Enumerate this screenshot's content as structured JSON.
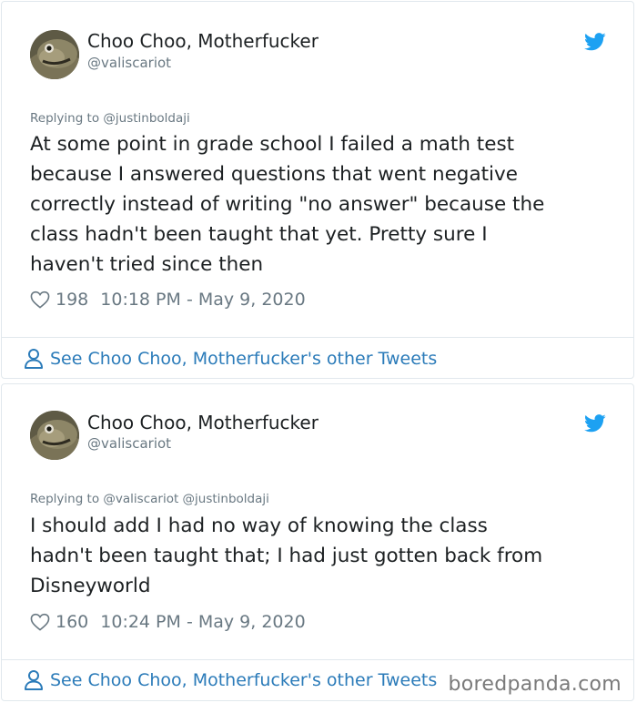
{
  "tweets": [
    {
      "author_name": "Choo Choo, Motherfucker",
      "author_handle": "@valiscariot",
      "replying_to": "Replying to @justinboldaji",
      "text_lines": [
        "At some point in grade school I failed a math test",
        "because I answered questions that went negative",
        "correctly instead of writing \"no answer\" because the",
        "class hadn't been taught that yet. Pretty sure I",
        "haven't tried since then"
      ],
      "likes": "198",
      "timestamp": "10:18 PM - May 9, 2020",
      "see_more": "See Choo Choo, Motherfucker's other Tweets"
    },
    {
      "author_name": "Choo Choo, Motherfucker",
      "author_handle": "@valiscariot",
      "replying_to": "Replying to @valiscariot @justinboldaji",
      "text_lines": [
        "I should add I had no way of knowing the class",
        "hadn't been taught that; I had just gotten back from",
        "Disneyworld"
      ],
      "likes": "160",
      "timestamp": "10:24 PM - May 9, 2020",
      "see_more": "See Choo Choo, Motherfucker's other Tweets"
    }
  ],
  "watermark": "boredpanda.com",
  "icons": {
    "brand": "twitter-bird-icon",
    "like": "heart-icon",
    "profile": "person-icon"
  },
  "colors": {
    "twitter_blue": "#1da1f2",
    "link_blue": "#2b7bb9",
    "secondary_text": "#697882",
    "primary_text": "#1c2022",
    "border": "#e1e8ed"
  }
}
